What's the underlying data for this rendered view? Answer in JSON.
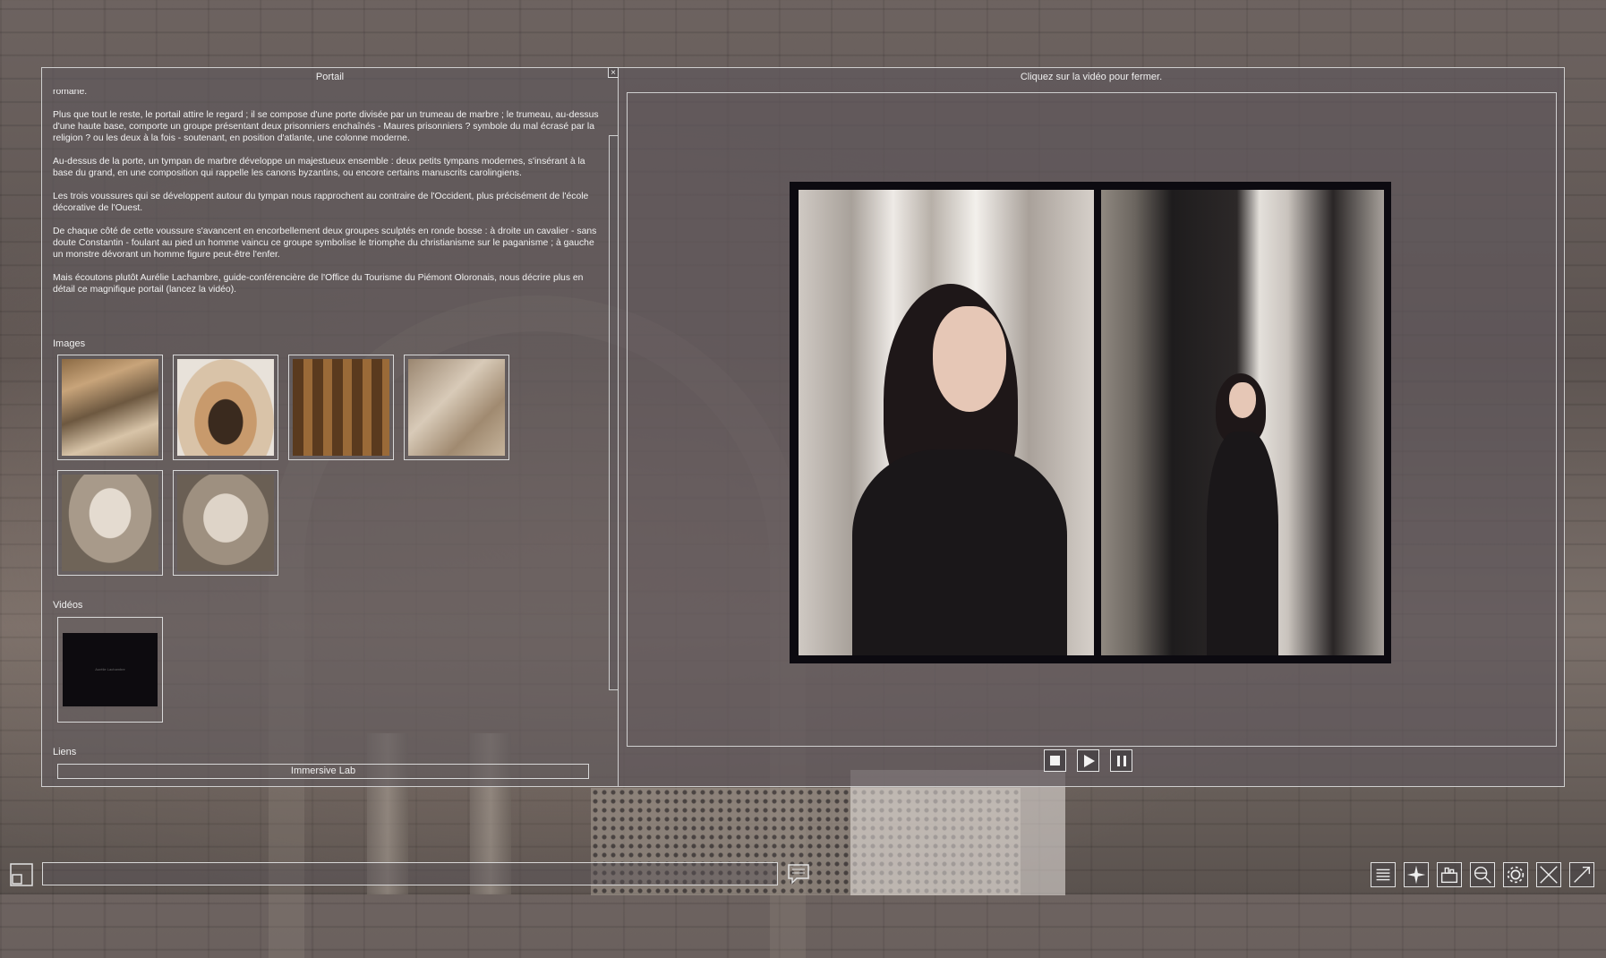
{
  "left_panel": {
    "title": "Portail",
    "close_glyph": "×",
    "paragraphs": [
      "romane.",
      "Plus que tout le reste, le portail attire le regard ; il se compose d'une porte divisée par un trumeau de marbre ; le trumeau, au-dessus d'une haute base, comporte un groupe présentant deux prisonniers enchaînés - Maures prisonniers ? symbole du mal écrasé par la religion ? ou les deux à la fois - soutenant, en position d'atlante, une colonne moderne.",
      "Au-dessus de la porte, un tympan de marbre développe un majestueux ensemble : deux petits tympans modernes, s'insérant à la base du grand, en une composition qui rappelle les canons byzantins, ou encore certains manuscrits carolingiens.",
      "Les trois voussures qui se développent autour du tympan nous rapprochent au contraire de l'Occident, plus précisément de l'école décorative de l'Ouest.",
      "De chaque côté de cette voussure s'avancent en encorbellement deux groupes sculptés en ronde bosse : à droite un cavalier - sans doute Constantin - foulant au pied un homme vaincu ce groupe symbolise le triomphe du christianisme sur le paganisme ; à gauche un monstre dévorant un homme figure peut-être l'enfer.",
      "Mais écoutons plutôt Aurélie Lachambre, guide-conférencière de l'Office du Tourisme du Piémont Oloronais, nous décrire plus en détail ce magnifique portail (lancez la vidéo)."
    ],
    "images_label": "Images",
    "videos_label": "Vidéos",
    "video_thumb_caption": "Aurélie Lachambre",
    "links_label": "Liens",
    "link_text": "Immersive Lab"
  },
  "right_panel": {
    "title": "Cliquez sur la vidéo pour fermer."
  },
  "controls": {
    "stop_icon": "stop-icon",
    "play_icon": "play-icon",
    "pause_icon": "pause-icon"
  },
  "toolbar": {
    "input_value": "",
    "icons": [
      "list-icon",
      "compass-icon",
      "building-icon",
      "search-globe-icon",
      "gear-icon",
      "collapse-icon",
      "expand-icon"
    ]
  },
  "colors": {
    "panel_bg": "#5f585c",
    "border": "#cfcfcf",
    "text": "#f2f2f2"
  }
}
